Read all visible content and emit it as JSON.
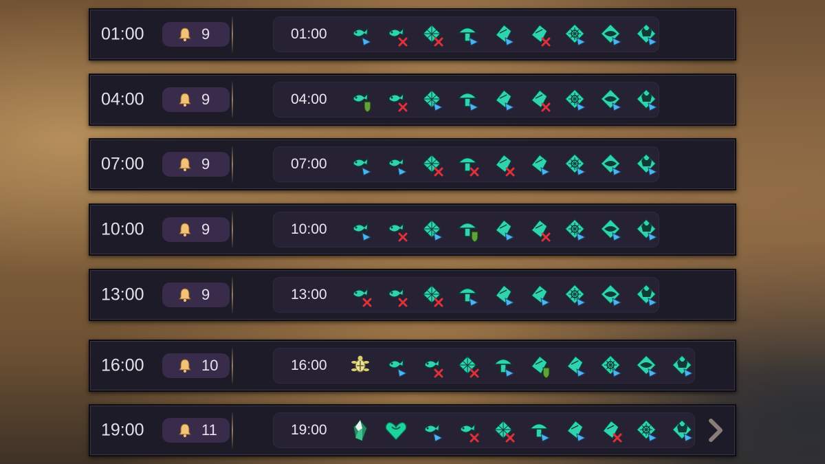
{
  "schedule": [
    {
      "time": "01:00",
      "count": "9",
      "panel_time": "01:00",
      "icons": [
        "spirit-fish-icon",
        "spirit-fish-crossed-icon",
        "spirit-net-crossed-icon",
        "spirit-mushroom-icon",
        "spirit-shard-icon",
        "spirit-shard-crossed-icon",
        "spirit-flower-icon",
        "spirit-ray-icon",
        "spirit-cat-icon"
      ]
    },
    {
      "time": "04:00",
      "count": "9",
      "panel_time": "04:00",
      "icons": [
        "spirit-fish-shield-icon",
        "spirit-fish-crossed-icon",
        "spirit-net-icon",
        "spirit-mushroom-icon",
        "spirit-shard-icon",
        "spirit-shard-crossed-icon",
        "spirit-flower-icon",
        "spirit-ray-icon",
        "spirit-cat-icon"
      ]
    },
    {
      "time": "07:00",
      "count": "9",
      "panel_time": "07:00",
      "icons": [
        "spirit-fish-icon",
        "spirit-fish-icon",
        "spirit-net-crossed-icon",
        "spirit-mushroom-crossed-icon",
        "spirit-shard-crossed-icon",
        "spirit-shard-icon",
        "spirit-flower-icon",
        "spirit-ray-icon",
        "spirit-cat-icon"
      ]
    },
    {
      "time": "10:00",
      "count": "9",
      "panel_time": "10:00",
      "icons": [
        "spirit-fish-icon",
        "spirit-fish-crossed-icon",
        "spirit-net-icon",
        "spirit-mushroom-shield-icon",
        "spirit-shard-icon",
        "spirit-shard-crossed-icon",
        "spirit-flower-icon",
        "spirit-ray-icon",
        "spirit-cat-icon"
      ]
    },
    {
      "time": "13:00",
      "count": "9",
      "panel_time": "13:00",
      "icons": [
        "spirit-fish-crossed-icon",
        "spirit-fish-crossed-icon",
        "spirit-net-crossed-icon",
        "spirit-mushroom-icon",
        "spirit-shard-icon",
        "spirit-shard-icon",
        "spirit-flower-icon",
        "spirit-ray-icon",
        "spirit-cat-icon"
      ]
    },
    {
      "time": "16:00",
      "count": "10",
      "panel_time": "16:00",
      "icons": [
        "turtle-icon",
        "spirit-fish-icon",
        "spirit-fish-crossed-icon",
        "spirit-net-crossed-icon",
        "spirit-mushroom-icon",
        "spirit-shard-shield-icon",
        "spirit-shard-icon",
        "spirit-flower-icon",
        "spirit-ray-icon",
        "spirit-cat-icon"
      ]
    },
    {
      "time": "19:00",
      "count": "11",
      "panel_time": "19:00",
      "icons": [
        "crystal-icon",
        "green-heart-icon",
        "spirit-fish-icon",
        "spirit-fish-crossed-icon",
        "spirit-net-crossed-icon",
        "spirit-mushroom-icon",
        "spirit-shard-icon",
        "spirit-shard-crossed-icon",
        "spirit-flower-icon",
        "spirit-cat-icon"
      ]
    }
  ],
  "colors": {
    "accent": "#2fd3b0",
    "arrow": "#4db3f0",
    "cross": "#e0303a",
    "badge": "#392c4b",
    "panel": "#262133"
  }
}
